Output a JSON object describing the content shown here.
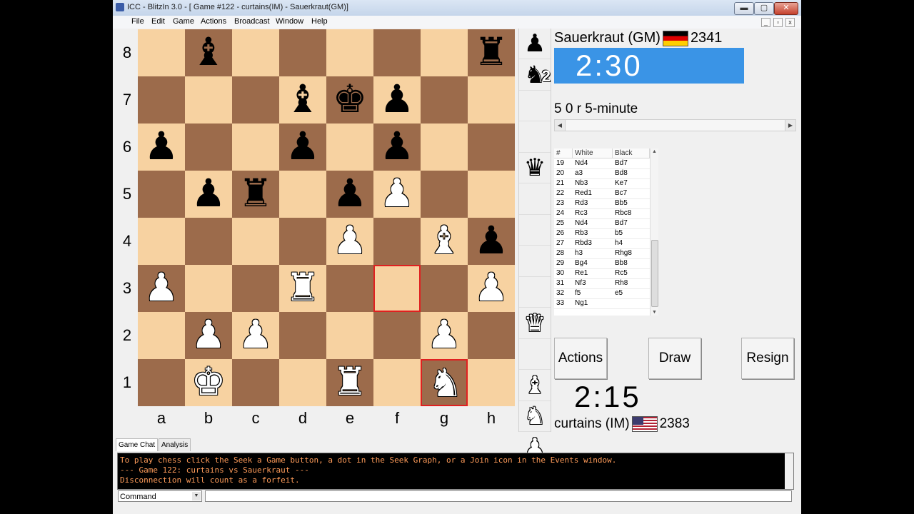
{
  "window": {
    "title": "ICC - BlitzIn 3.0 - [ Game #122 - curtains(IM) - Sauerkraut(GM)]",
    "controls": {
      "minimize": "▬",
      "maximize": "▢",
      "close": "✕"
    }
  },
  "menu": [
    "File",
    "Edit",
    "Game",
    "Actions",
    "Broadcast",
    "Window",
    "Help"
  ],
  "mdi_controls": [
    "_",
    "▫",
    "x"
  ],
  "board": {
    "ranks": [
      "8",
      "7",
      "6",
      "5",
      "4",
      "3",
      "2",
      "1"
    ],
    "files": [
      "a",
      "b",
      "c",
      "d",
      "e",
      "f",
      "g",
      "h"
    ],
    "colors": {
      "light": "#f7d2a1",
      "dark": "#9c6b4b",
      "highlight": "#e02020"
    },
    "highlighted_squares": [
      "f3",
      "g1"
    ],
    "pieces": [
      {
        "square": "b8",
        "piece": "bishop",
        "color": "black",
        "glyph": "♝"
      },
      {
        "square": "h8",
        "piece": "rook",
        "color": "black",
        "glyph": "♜"
      },
      {
        "square": "d7",
        "piece": "bishop",
        "color": "black",
        "glyph": "♝"
      },
      {
        "square": "e7",
        "piece": "king",
        "color": "black",
        "glyph": "♚"
      },
      {
        "square": "f7",
        "piece": "pawn",
        "color": "black",
        "glyph": "♟"
      },
      {
        "square": "a6",
        "piece": "pawn",
        "color": "black",
        "glyph": "♟"
      },
      {
        "square": "d6",
        "piece": "pawn",
        "color": "black",
        "glyph": "♟"
      },
      {
        "square": "f6",
        "piece": "pawn",
        "color": "black",
        "glyph": "♟"
      },
      {
        "square": "b5",
        "piece": "pawn",
        "color": "black",
        "glyph": "♟"
      },
      {
        "square": "c5",
        "piece": "rook",
        "color": "black",
        "glyph": "♜"
      },
      {
        "square": "e5",
        "piece": "pawn",
        "color": "black",
        "glyph": "♟"
      },
      {
        "square": "f5",
        "piece": "pawn",
        "color": "white",
        "glyph": "♟"
      },
      {
        "square": "e4",
        "piece": "pawn",
        "color": "white",
        "glyph": "♟"
      },
      {
        "square": "g4",
        "piece": "bishop",
        "color": "white",
        "glyph": "♝"
      },
      {
        "square": "h4",
        "piece": "pawn",
        "color": "black",
        "glyph": "♟"
      },
      {
        "square": "a3",
        "piece": "pawn",
        "color": "white",
        "glyph": "♟"
      },
      {
        "square": "d3",
        "piece": "rook",
        "color": "white",
        "glyph": "♜"
      },
      {
        "square": "h3",
        "piece": "pawn",
        "color": "white",
        "glyph": "♟"
      },
      {
        "square": "b2",
        "piece": "pawn",
        "color": "white",
        "glyph": "♟"
      },
      {
        "square": "c2",
        "piece": "pawn",
        "color": "white",
        "glyph": "♟"
      },
      {
        "square": "g2",
        "piece": "pawn",
        "color": "white",
        "glyph": "♟"
      },
      {
        "square": "b1",
        "piece": "king",
        "color": "white",
        "glyph": "♚"
      },
      {
        "square": "e1",
        "piece": "rook",
        "color": "white",
        "glyph": "♜"
      },
      {
        "square": "g1",
        "piece": "knight",
        "color": "white",
        "glyph": "♞"
      }
    ]
  },
  "captures": [
    {
      "slot": 0,
      "piece": "pawn",
      "color": "black",
      "glyph": "♟",
      "count": ""
    },
    {
      "slot": 1,
      "piece": "knight",
      "color": "black",
      "glyph": "♞",
      "count": "2"
    },
    {
      "slot": 4,
      "piece": "queen",
      "color": "black",
      "glyph": "♛",
      "count": ""
    },
    {
      "slot": 9,
      "piece": "queen",
      "color": "white",
      "glyph": "♛",
      "count": ""
    },
    {
      "slot": 11,
      "piece": "bishop",
      "color": "white",
      "glyph": "♝",
      "count": ""
    },
    {
      "slot": 12,
      "piece": "knight",
      "color": "white",
      "glyph": "♞",
      "count": ""
    },
    {
      "slot": 13,
      "piece": "pawn",
      "color": "white",
      "glyph": "♟",
      "count": ""
    }
  ],
  "top_player": {
    "name": "Sauerkraut (GM)",
    "flag": "germany",
    "rating": "2341",
    "clock": "2:30",
    "clock_color": "#3a94e6"
  },
  "game_type": "5 0 r 5-minute",
  "moves": {
    "headers": [
      "#",
      "White",
      "Black"
    ],
    "rows": [
      [
        "19",
        "Nd4",
        "Bd7"
      ],
      [
        "20",
        "a3",
        "Bd8"
      ],
      [
        "21",
        "Nb3",
        "Ke7"
      ],
      [
        "22",
        "Red1",
        "Bc7"
      ],
      [
        "23",
        "Rd3",
        "Bb5"
      ],
      [
        "24",
        "Rc3",
        "Rbc8"
      ],
      [
        "25",
        "Nd4",
        "Bd7"
      ],
      [
        "26",
        "Rb3",
        "b5"
      ],
      [
        "27",
        "Rbd3",
        "h4"
      ],
      [
        "28",
        "h3",
        "Rhg8"
      ],
      [
        "29",
        "Bg4",
        "Bb8"
      ],
      [
        "30",
        "Re1",
        "Rc5"
      ],
      [
        "31",
        "Nf3",
        "Rh8"
      ],
      [
        "32",
        "f5",
        "e5"
      ],
      [
        "33",
        "Ng1",
        ""
      ]
    ]
  },
  "buttons": {
    "actions": "Actions",
    "draw": "Draw",
    "resign": "Resign"
  },
  "bottom_player": {
    "name": "curtains (IM)",
    "flag": "usa",
    "rating": "2383",
    "clock": "2:15"
  },
  "chat": {
    "tabs": [
      "Game Chat",
      "Analysis"
    ],
    "lines": [
      "To play chess click the Seek a Game button, a dot in the Seek Graph, or a Join icon in the Events window.",
      "--- Game 122: curtains vs Sauerkraut ---",
      "Disconnection will count as a forfeit."
    ],
    "text_color": "#ff9c5a"
  },
  "command": {
    "selected": "Command",
    "input_value": ""
  }
}
